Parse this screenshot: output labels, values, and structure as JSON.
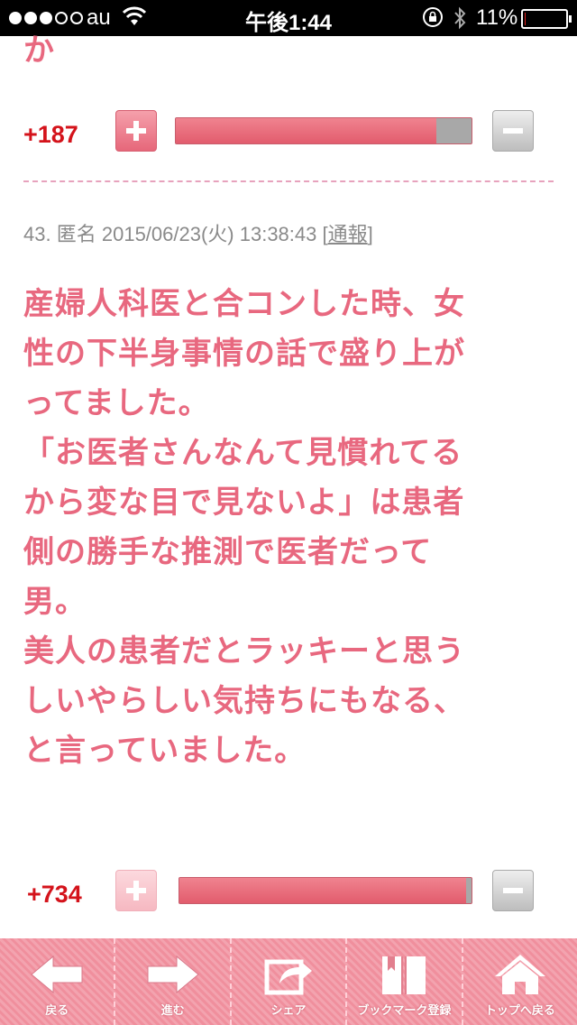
{
  "status_bar": {
    "carrier": "au",
    "time": "午後1:44",
    "battery_percent": "11%",
    "battery_level": 0.11,
    "signal_bars_filled": 3,
    "signal_bars_total": 5
  },
  "previous_comment": {
    "text_fragment": "か",
    "vote_count": "+187",
    "vote_ratio": 0.88
  },
  "comment": {
    "number": "43.",
    "author": "匿名",
    "datetime": "2015/06/23(火) 13:38:43",
    "report_open": "[",
    "report_label": "通報",
    "report_close": "]",
    "body": "産婦人科医と合コンした時、女\n性の下半身事情の話で盛り上が\nってました。\n「お医者さんなんて見慣れてる\nから変な目で見ないよ」は患者\n側の勝手な推測で医者だって\n男。\n美人の患者だとラッキーと思う\nしいやらしい気持ちにもなる、\nと言っていました。",
    "vote_count": "+734",
    "vote_ratio": 0.98
  },
  "toolbar": {
    "back_label": "戻る",
    "forward_label": "進む",
    "share_label": "シェア",
    "bookmark_label": "ブックマーク登録",
    "top_label": "トップへ戻る"
  },
  "colors": {
    "accent_pink": "#e8687f",
    "vote_red": "#d4131b",
    "toolbar_pink": "#f08f9d"
  }
}
